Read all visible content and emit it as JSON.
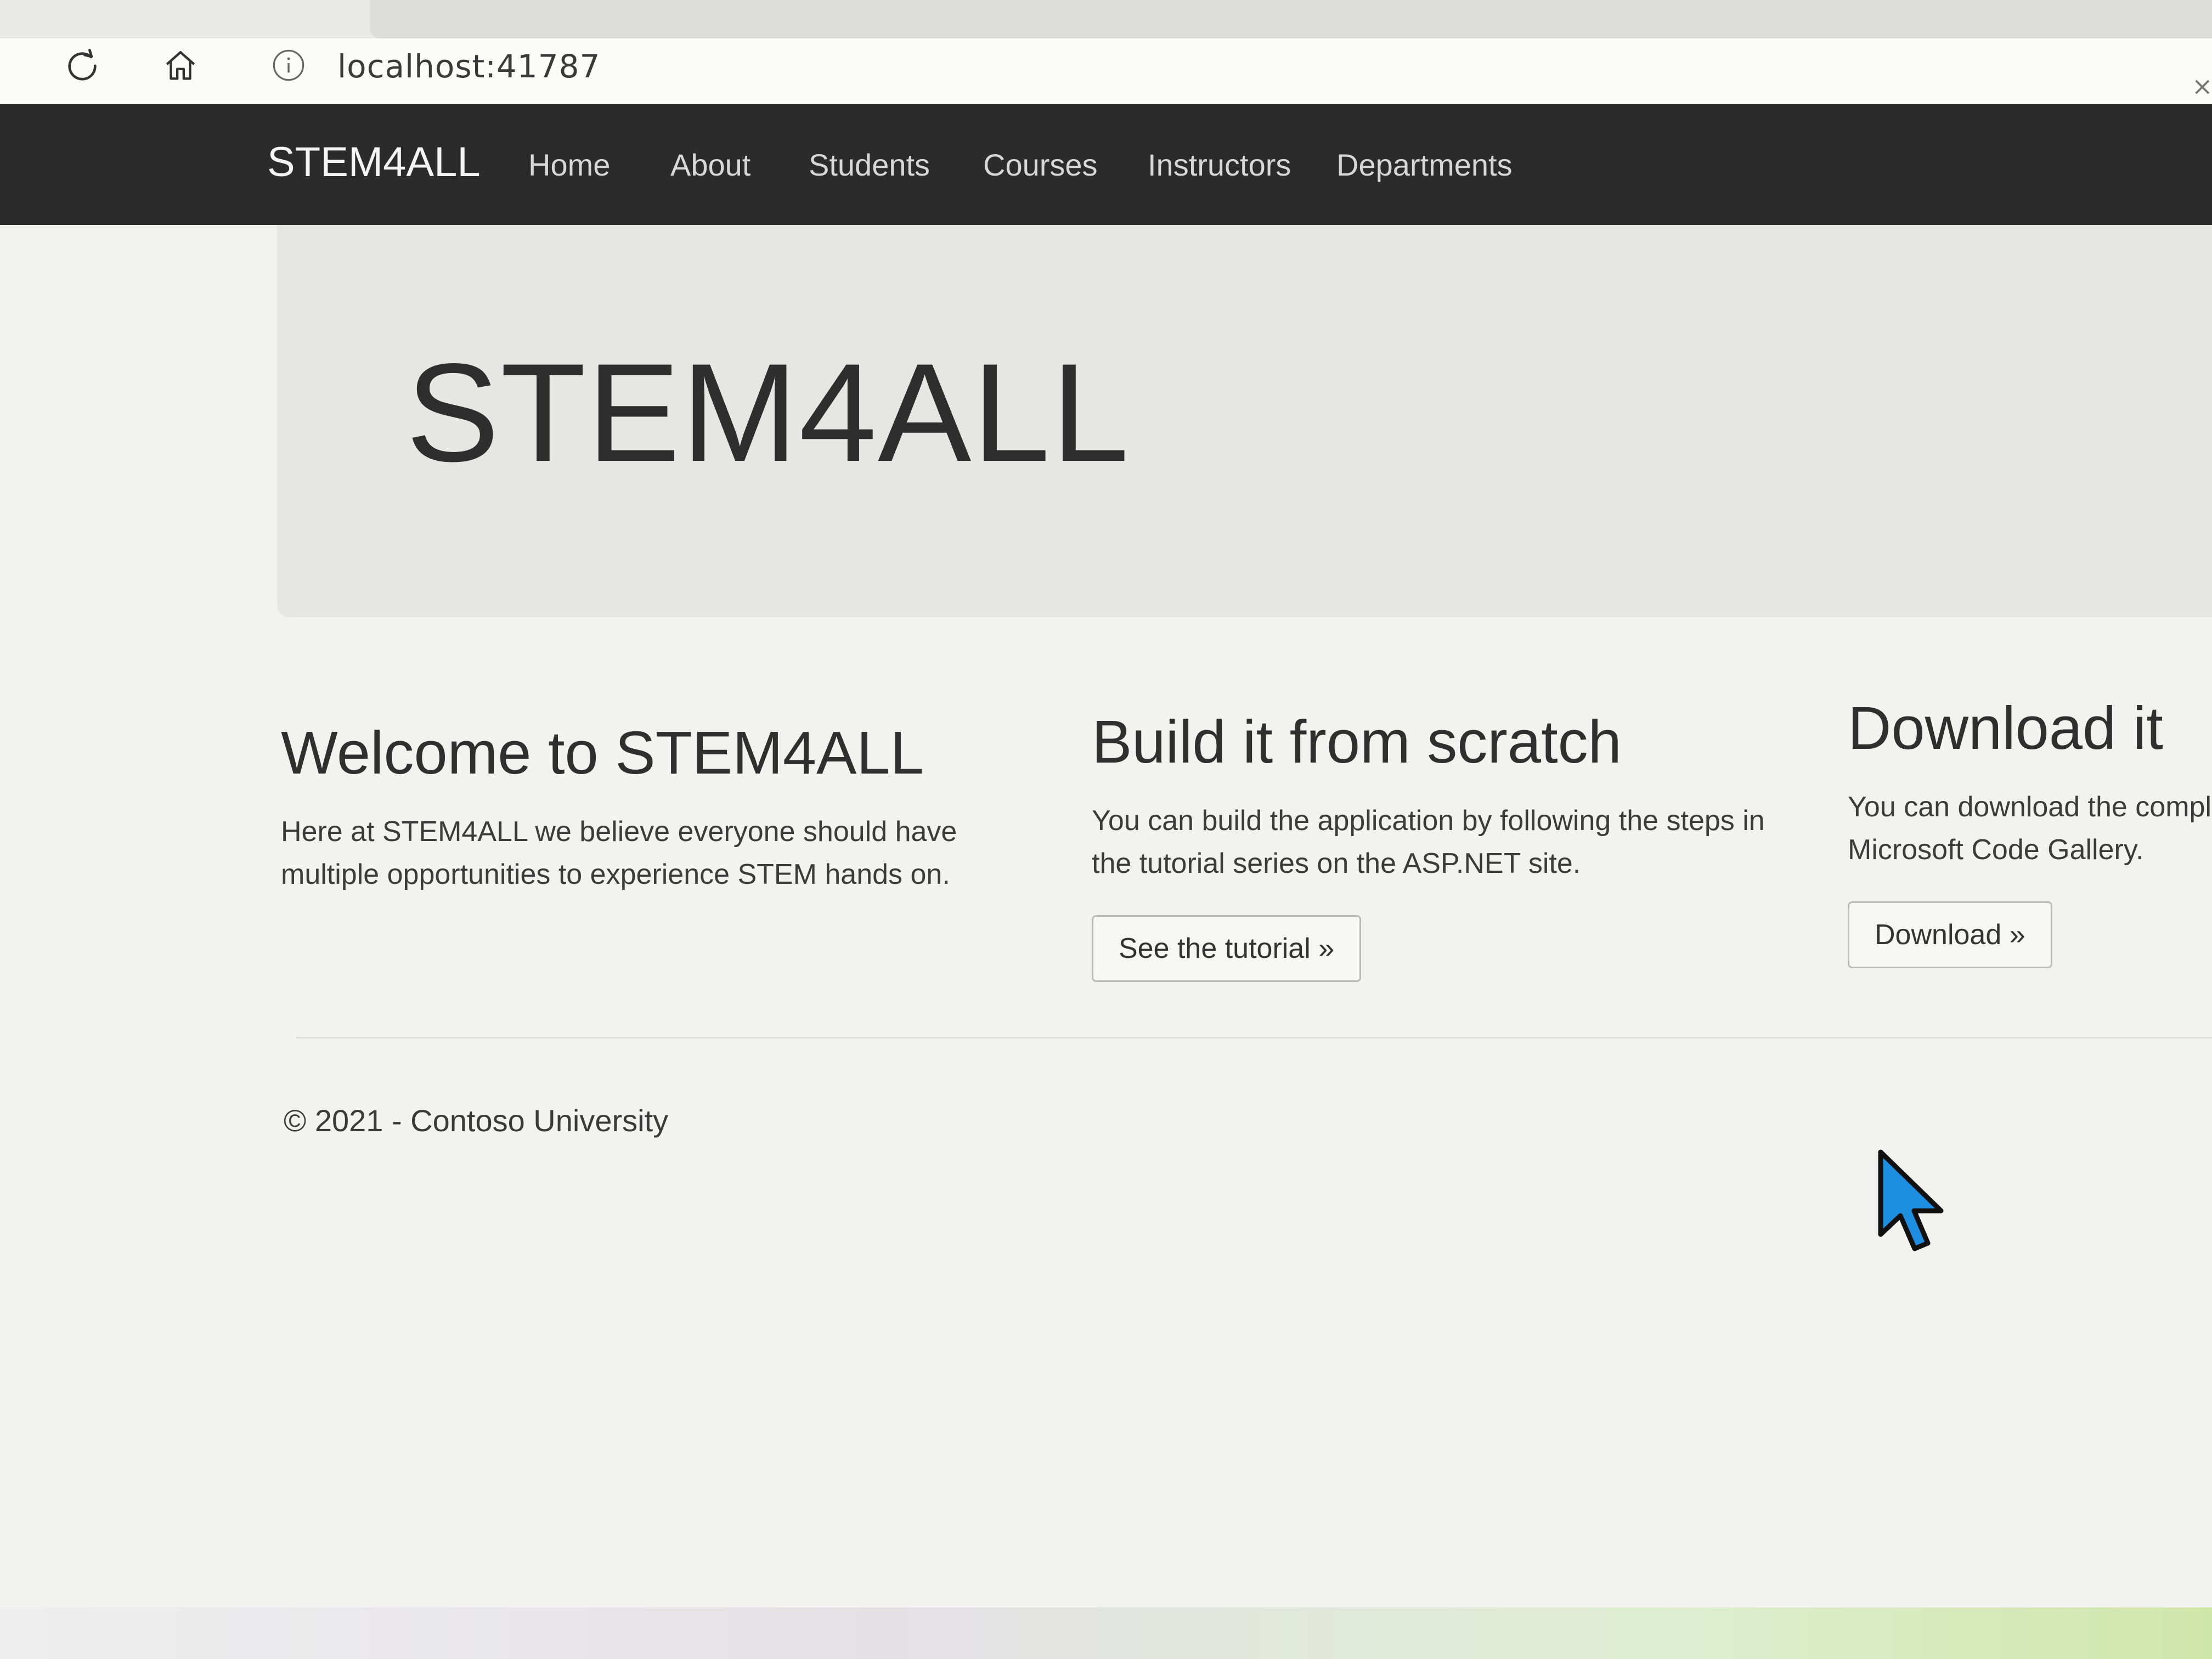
{
  "browser": {
    "url": "localhost:41787",
    "icons": [
      "refresh-icon",
      "home-icon",
      "site-info-icon"
    ]
  },
  "navbar": {
    "brand": "STEM4ALL",
    "links": [
      {
        "label": "Home"
      },
      {
        "label": "About"
      },
      {
        "label": "Students"
      },
      {
        "label": "Courses"
      },
      {
        "label": "Instructors"
      },
      {
        "label": "Departments"
      }
    ]
  },
  "jumbotron": {
    "title": "STEM4ALL"
  },
  "columns": [
    {
      "heading": "Welcome to STEM4ALL",
      "text": "Here at STEM4ALL we believe everyone should have multiple opportunities to experience STEM hands on."
    },
    {
      "heading": "Build it from scratch",
      "text": "You can build the application by following the steps in the tutorial series on the ASP.NET site.",
      "button": "See the tutorial »"
    },
    {
      "heading": "Download it",
      "line1": "You can download the complete",
      "line2": "Microsoft Code Gallery.",
      "button": "Download »"
    }
  ],
  "footer": {
    "text": "© 2021 - Contoso University"
  },
  "colors": {
    "navbar_bg": "#2b2b2b",
    "page_bg": "#f2f2f0",
    "jumbotron_bg": "#e6e6e4",
    "cursor_fill": "#1e8fe0"
  }
}
